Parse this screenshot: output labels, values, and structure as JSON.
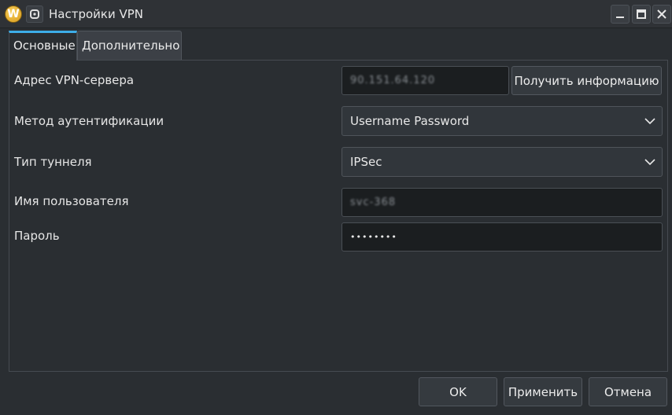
{
  "window": {
    "title": "Настройки VPN",
    "app_icon_letter": "W"
  },
  "tabs": {
    "main": "Основные",
    "extra": "Дополнительно"
  },
  "form": {
    "server_label": "Адрес VPN-сервера",
    "server_value": "90.151.64.120",
    "get_info_button": "Получить информацию",
    "auth_label": "Метод аутентификации",
    "auth_value": "Username Password",
    "tunnel_label": "Тип туннеля",
    "tunnel_value": "IPSec",
    "user_label": "Имя пользователя",
    "user_value": "svc-368",
    "password_label": "Пароль",
    "password_mask": "••••••••"
  },
  "footer": {
    "ok": "OK",
    "apply": "Применить",
    "cancel": "Отмена"
  }
}
